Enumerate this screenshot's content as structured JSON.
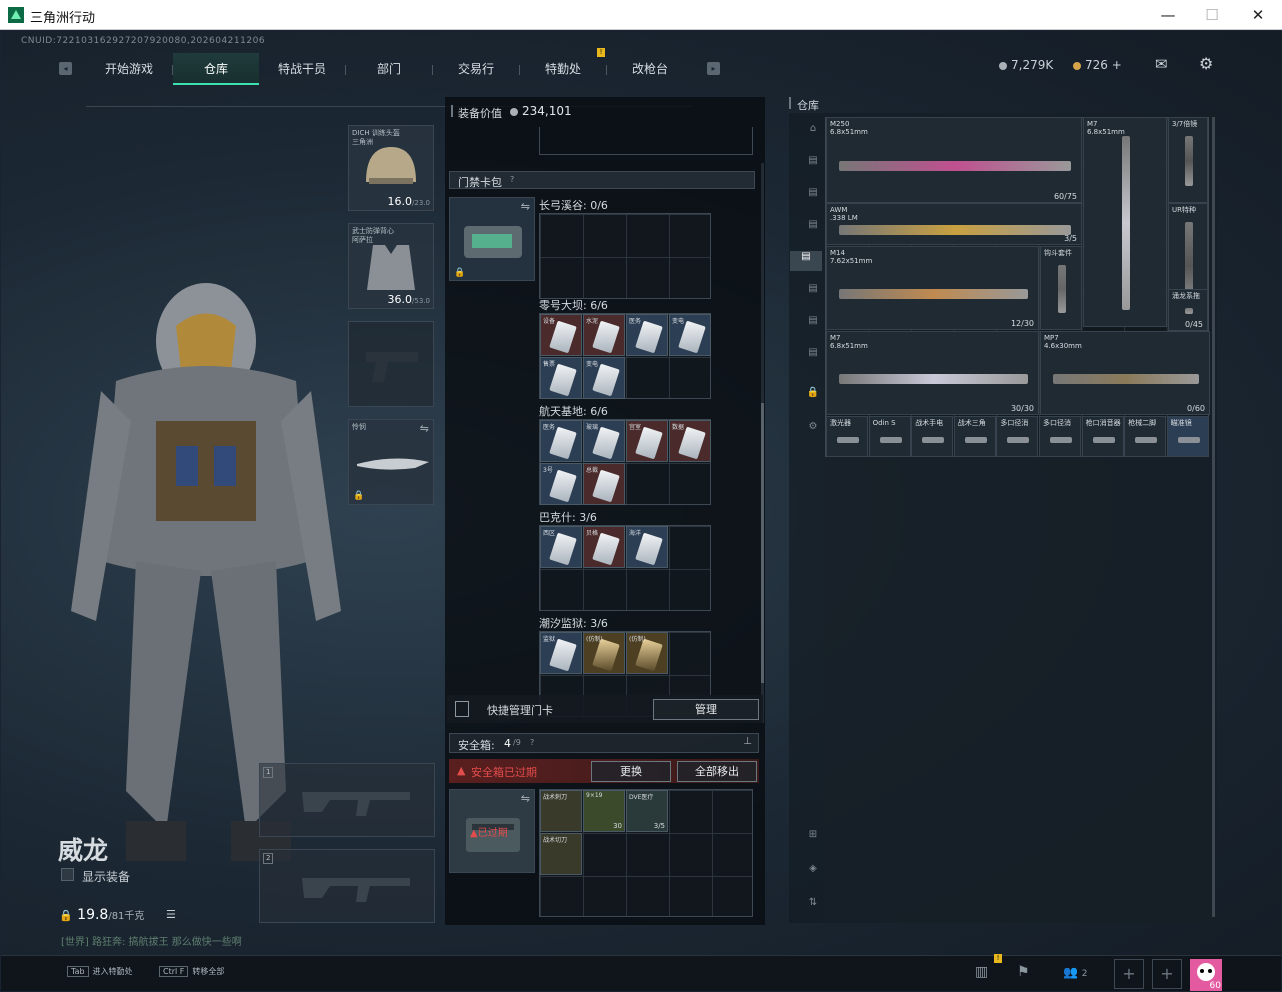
{
  "window": {
    "title": "三角洲行动",
    "minimize": "—",
    "maximize": "☐",
    "close": "✕"
  },
  "uid": "CNUID:722103162927207920080,202604211206",
  "nav": {
    "tabs": [
      "开始游戏",
      "仓库",
      "特战干员",
      "部门",
      "交易行",
      "特勤处",
      "改枪台"
    ],
    "active": "仓库",
    "notice_badge": "!"
  },
  "currency": {
    "silver": "7,279K",
    "gold": "726",
    "gold_add": "+"
  },
  "loadout": {
    "helmet": {
      "label": "DICH 训练头盔\n三角洲",
      "value": "16.0",
      "max": "/23.0"
    },
    "armor": {
      "label": "武士防弹背心\n阿萨拉",
      "value": "36.0",
      "max": "/53.0"
    },
    "melee_label": "怜悯",
    "slot1": "1",
    "slot2": "2"
  },
  "operator": {
    "name": "威龙",
    "show_gear": "显示装备",
    "weight": "19.8",
    "weight_max": "/81千克",
    "chat": "[世界] 路狂奔: 搞航拔王 那么做快一些啊"
  },
  "center": {
    "equip_value_label": "装备价值",
    "equip_value": "234,101",
    "keycard_pack": "门禁卡包",
    "help": "?",
    "maps": [
      {
        "name": "长弓溪谷: 0/6",
        "cards": []
      },
      {
        "name": "零号大坝: 6/6",
        "cards": [
          "设备",
          "水泥",
          "医务",
          "变电",
          "售票",
          "变电"
        ]
      },
      {
        "name": "航天基地: 6/6",
        "cards": [
          "医务",
          "玻璃",
          "宫室",
          "数据",
          "3号",
          "总裁"
        ]
      },
      {
        "name": "巴克什: 3/6",
        "cards": [
          "西区",
          "贝格",
          "海洋"
        ]
      },
      {
        "name": "潮汐监狱: 3/6",
        "cards": [
          "监狱",
          "(仿制)",
          "(仿制)"
        ]
      }
    ],
    "quick_manage": "快捷管理门卡",
    "manage_btn": "管理",
    "safe_box": "安全箱:",
    "safe_count": "4",
    "safe_total": "/9",
    "safe_expired": "安全箱已过期",
    "expired_short": "已过期",
    "replace_btn": "更换",
    "move_all_btn": "全部移出",
    "safe_items": [
      {
        "name": "战术刺刀",
        "count": ""
      },
      {
        "name": "9×19",
        "count": "30"
      },
      {
        "name": "DVE医疗",
        "count": "3/5"
      },
      {
        "name": "战术切刀",
        "count": ""
      }
    ]
  },
  "warehouse": {
    "title": "仓库",
    "weapons": [
      {
        "name": "M250\n6.8x51mm",
        "count": "60/75"
      },
      {
        "name": "M7\n6.8x51mm",
        "count": ""
      },
      {
        "name": "3/7倍镜",
        "count": ""
      },
      {
        "name": "AWM\n.338 LM",
        "count": "3/5"
      },
      {
        "name": "UR特种",
        "count": ""
      },
      {
        "name": "M14\n7.62x51mm",
        "count": "12/30"
      },
      {
        "name": "钩斗套件",
        "count": ""
      },
      {
        "name": "涌龙系拖",
        "count": "0/45"
      },
      {
        "name": "M7\n6.8x51mm",
        "count": "30/30"
      },
      {
        "name": "MP7\n4.6x30mm",
        "count": "0/60"
      }
    ],
    "attachments": [
      "激光器",
      "Odin S",
      "战术手电",
      "战术三角",
      "多口径消",
      "多口径消",
      "枪口消音器",
      "枪械二脚",
      "瞄准镜"
    ]
  },
  "bottom": {
    "hint1_key": "Tab",
    "hint1": "进入特勤处",
    "hint2_key": "Ctrl F",
    "hint2": "转移全部",
    "friends": "2",
    "level": "60"
  }
}
